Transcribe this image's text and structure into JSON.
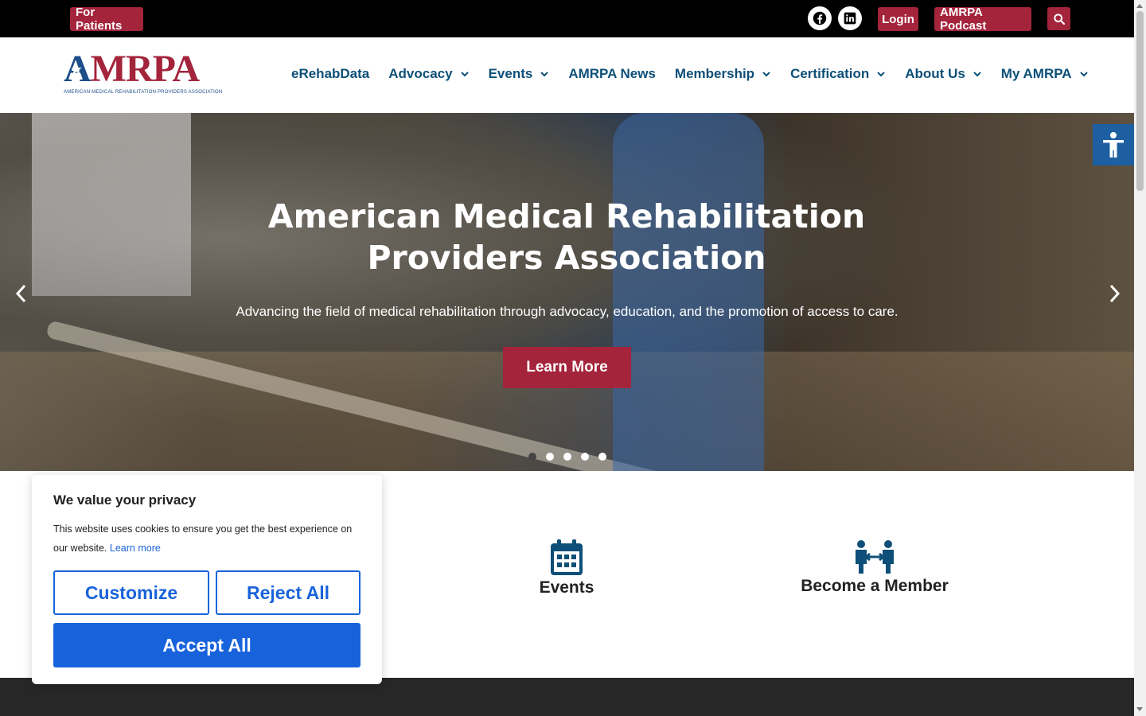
{
  "topbar": {
    "for_patients": "For Patients",
    "login": "Login",
    "podcast": "AMRPA Podcast",
    "social_icons": [
      "facebook-icon",
      "linkedin-icon"
    ]
  },
  "logo": {
    "text_red": "AMRPA",
    "subtitle": "AMERICAN MEDICAL REHABILITATION PROVIDERS ASSOCIATION"
  },
  "nav": {
    "items": [
      {
        "label": "eRehabData",
        "dropdown": false
      },
      {
        "label": "Advocacy",
        "dropdown": true
      },
      {
        "label": "Events",
        "dropdown": true
      },
      {
        "label": "AMRPA News",
        "dropdown": false
      },
      {
        "label": "Membership",
        "dropdown": true
      },
      {
        "label": "Certification",
        "dropdown": true
      },
      {
        "label": "About Us",
        "dropdown": true
      },
      {
        "label": "My AMRPA",
        "dropdown": true
      }
    ]
  },
  "hero": {
    "title": "American Medical Rehabilitation Providers Association",
    "subtitle": "Advancing the field of medical rehabilitation through advocacy, education, and the promotion of access to care.",
    "cta": "Learn More",
    "slides": 5,
    "active_slide": 1
  },
  "features": {
    "events": "Events",
    "member": "Become a Member"
  },
  "cookie": {
    "title": "We value your privacy",
    "text": "This website uses cookies to ensure you get the best experience on our website.",
    "learn_more": "Learn more",
    "customize": "Customize",
    "reject": "Reject All",
    "accept": "Accept All"
  },
  "colors": {
    "brand_red": "#a3243b",
    "nav_blue": "#0d4f78",
    "cookie_blue": "#1863dc",
    "access_blue": "#1d5fa0"
  }
}
